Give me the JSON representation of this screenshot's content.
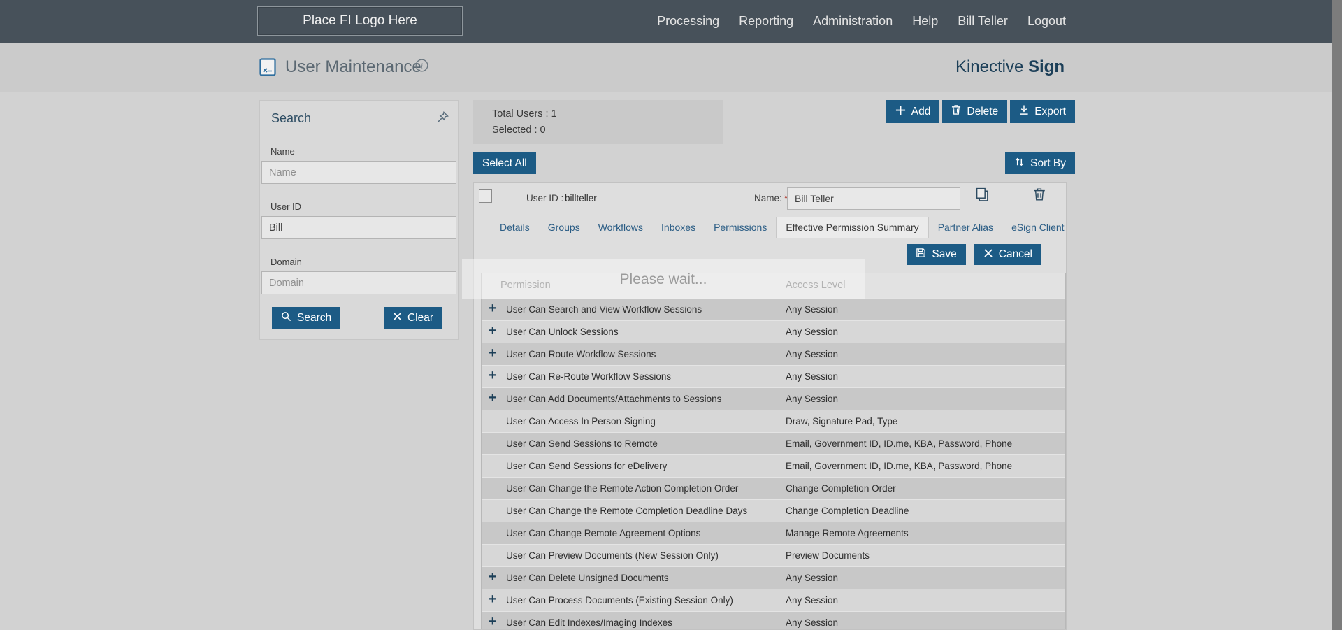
{
  "colors": {
    "accent_blue": "#1c5b85",
    "brand_navy": "#1c3f58"
  },
  "topbar": {
    "logo": "Place FI Logo Here",
    "nav": [
      "Processing",
      "Reporting",
      "Administration",
      "Help",
      "Bill Teller",
      "Logout"
    ]
  },
  "header": {
    "title": "User Maintenance",
    "brand_regular": "Kinective ",
    "brand_bold": "Sign"
  },
  "search_panel": {
    "title": "Search",
    "fields": [
      {
        "label": "Name",
        "placeholder": "Name",
        "value": ""
      },
      {
        "label": "User ID",
        "placeholder": "",
        "value": "Bill"
      },
      {
        "label": "Domain",
        "placeholder": "Domain",
        "value": ""
      }
    ],
    "search_label": "Search",
    "clear_label": "Clear"
  },
  "toolbar": {
    "total_users": "Total Users : 1",
    "selected": "Selected : 0",
    "add": "Add",
    "delete": "Delete",
    "export": "Export",
    "select_all": "Select All",
    "sort_by": "Sort By"
  },
  "user_card": {
    "user_id_label": "User ID :",
    "user_id": "billteller",
    "name_label": "Name:",
    "required_mark": "*",
    "name_value": "Bill Teller",
    "tabs": [
      {
        "label": "Details",
        "active": false
      },
      {
        "label": "Groups",
        "active": false
      },
      {
        "label": "Workflows",
        "active": false
      },
      {
        "label": "Inboxes",
        "active": false
      },
      {
        "label": "Permissions",
        "active": false
      },
      {
        "label": "Effective Permission Summary",
        "active": true
      },
      {
        "label": "Partner Alias",
        "active": false
      },
      {
        "label": "eSign Client",
        "active": false
      }
    ],
    "save": "Save",
    "cancel": "Cancel"
  },
  "overlay": {
    "message": "Please wait..."
  },
  "icons": {
    "search": "magnifier",
    "clear": "x",
    "add": "plus",
    "delete": "trash",
    "export": "download-arrow",
    "sort_by": "up-down-arrows",
    "save": "floppy-disk",
    "cancel": "x",
    "copy": "copy-pages",
    "user_delete": "trash",
    "pin": "pushpin",
    "info": "info-circle",
    "expand": "plus"
  },
  "table": {
    "columns": [
      "Permission",
      "Access Level"
    ],
    "rows": [
      {
        "expandable": true,
        "permission": "User Can Search and View Workflow Sessions",
        "access": "Any Session"
      },
      {
        "expandable": true,
        "permission": "User Can Unlock Sessions",
        "access": "Any Session"
      },
      {
        "expandable": true,
        "permission": "User Can Route Workflow Sessions",
        "access": "Any Session"
      },
      {
        "expandable": true,
        "permission": "User Can Re-Route Workflow Sessions",
        "access": "Any Session"
      },
      {
        "expandable": true,
        "permission": "User Can Add Documents/Attachments to Sessions",
        "access": "Any Session"
      },
      {
        "expandable": false,
        "permission": "User Can Access In Person Signing",
        "access": "Draw, Signature Pad, Type"
      },
      {
        "expandable": false,
        "permission": "User Can Send Sessions to Remote",
        "access": "Email, Government ID, ID.me, KBA, Password, Phone"
      },
      {
        "expandable": false,
        "permission": "User Can Send Sessions for eDelivery",
        "access": "Email, Government ID, ID.me, KBA, Password, Phone"
      },
      {
        "expandable": false,
        "permission": "User Can Change the Remote Action Completion Order",
        "access": "Change Completion Order"
      },
      {
        "expandable": false,
        "permission": "User Can Change the Remote Completion Deadline Days",
        "access": "Change Completion Deadline"
      },
      {
        "expandable": false,
        "permission": "User Can Change Remote Agreement Options",
        "access": "Manage Remote Agreements"
      },
      {
        "expandable": false,
        "permission": "User Can Preview Documents (New Session Only)",
        "access": "Preview Documents"
      },
      {
        "expandable": true,
        "permission": "User Can Delete Unsigned Documents",
        "access": "Any Session"
      },
      {
        "expandable": true,
        "permission": "User Can Process Documents (Existing Session Only)",
        "access": "Any Session"
      },
      {
        "expandable": true,
        "permission": "User Can Edit Indexes/Imaging Indexes",
        "access": "Any Session"
      }
    ]
  }
}
